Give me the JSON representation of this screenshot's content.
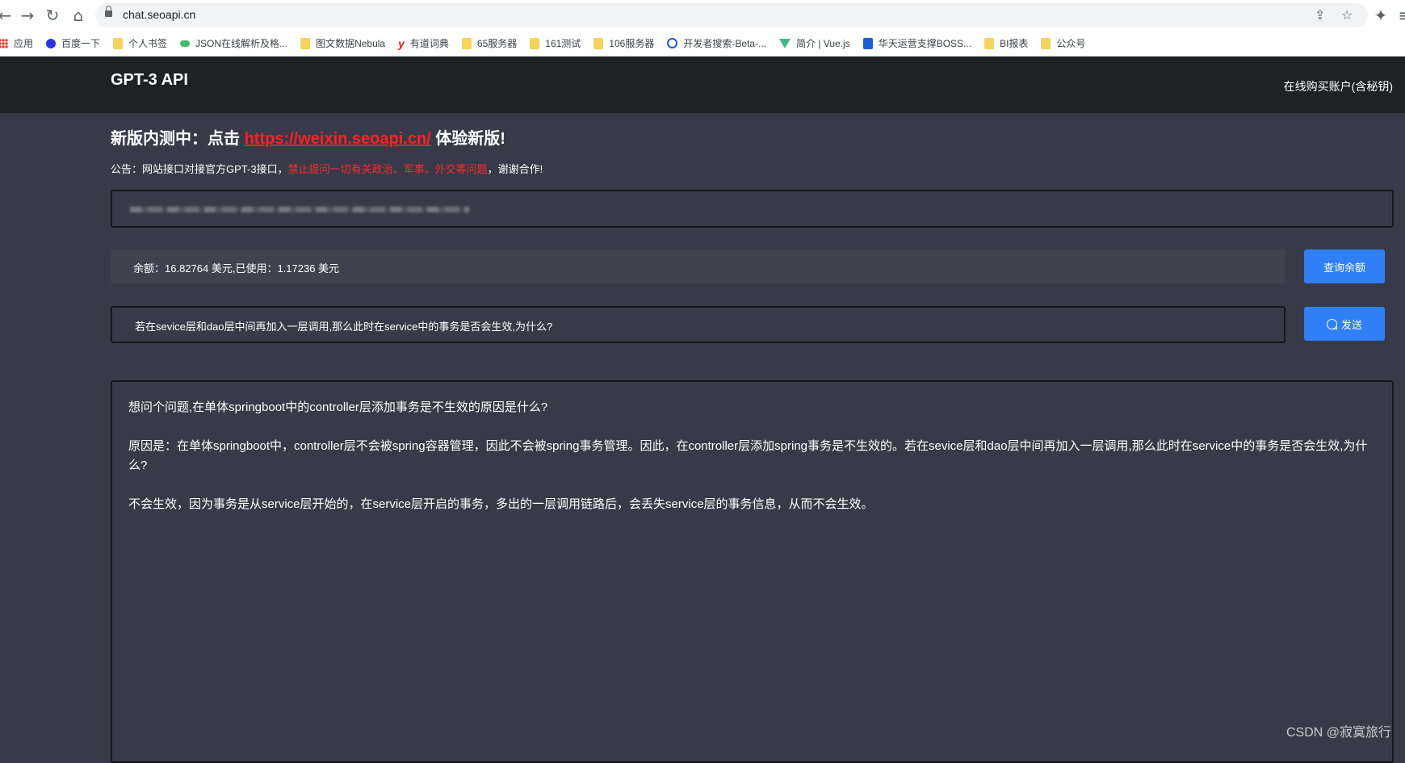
{
  "browser": {
    "url": "chat.seoapi.cn",
    "bookmarks": [
      {
        "label": "应用",
        "icon": "apps-grid-icon"
      },
      {
        "label": "百度一下",
        "icon": "baidu-paw-icon"
      },
      {
        "label": "个人书签",
        "icon": "folder-icon"
      },
      {
        "label": "JSON在线解析及格...",
        "icon": "json-icon"
      },
      {
        "label": "图文数据Nebula",
        "icon": "folder-icon"
      },
      {
        "label": "有道词典",
        "icon": "youdao-icon"
      },
      {
        "label": "65服务器",
        "icon": "folder-icon"
      },
      {
        "label": "161测试",
        "icon": "folder-icon"
      },
      {
        "label": "106服务器",
        "icon": "folder-icon"
      },
      {
        "label": "开发者搜索-Beta-...",
        "icon": "dev-search-icon"
      },
      {
        "label": "简介 | Vue.js",
        "icon": "vue-icon"
      },
      {
        "label": "华天运营支撑BOSS...",
        "icon": "huatian-icon"
      },
      {
        "label": "BI报表",
        "icon": "folder-icon"
      },
      {
        "label": "公众号",
        "icon": "folder-icon"
      }
    ]
  },
  "header": {
    "title": "GPT-3 API",
    "buy_link": "在线购买账户(含秘钥)"
  },
  "promo": {
    "prefix": "新版内测中：点击 ",
    "link": "https://weixin.seoapi.cn/",
    "suffix": " 体验新版!"
  },
  "notice": {
    "prefix": "公告：网站接口对接官方GPT-3接口，",
    "warning": "禁止提问一切有关政治、军事、外交等问题",
    "suffix": "，谢谢合作!"
  },
  "balance": {
    "text": "余额：16.82764 美元,已使用：1.17236 美元",
    "query_button": "查询余额"
  },
  "question": {
    "value": "若在sevice层和dao层中间再加入一层调用,那么此时在service中的事务是否会生效,为什么?",
    "send_button": "发送"
  },
  "answer": {
    "paragraphs": [
      "想问个问题,在单体springboot中的controller层添加事务是不生效的原因是什么?",
      "原因是：在单体springboot中，controller层不会被spring容器管理，因此不会被spring事务管理。因此，在controller层添加spring事务是不生效的。若在sevice层和dao层中间再加入一层调用,那么此时在service中的事务是否会生效,为什么?",
      "不会生效，因为事务是从service层开始的，在service层开启的事务，多出的一层调用链路后，会丢失service层的事务信息，从而不会生效。"
    ]
  },
  "watermark": "CSDN @寂寞旅行"
}
